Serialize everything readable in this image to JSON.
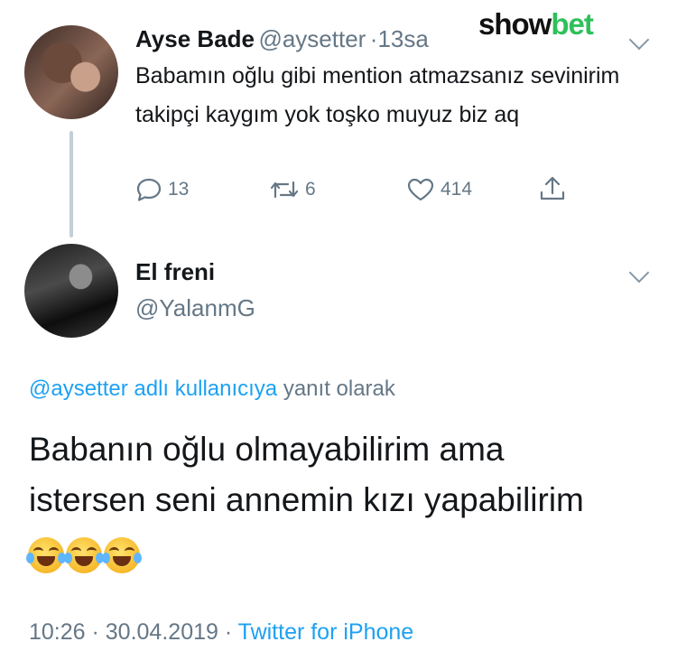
{
  "watermark": {
    "part1": "show",
    "part2": "bet"
  },
  "tweet1": {
    "author_name": "Ayse Bade",
    "author_handle": "@aysetter",
    "separator": "·",
    "time": "13sa",
    "text": "Babamın oğlu gibi mention atmazsanız sevinirim takipçi kaygım yok toşko muyuz biz aq",
    "actions": {
      "replies": "13",
      "retweets": "6",
      "likes": "414"
    }
  },
  "tweet2": {
    "author_name": "El freni",
    "author_handle": "@YalanmG",
    "reply_to_link": "@aysetter adlı kullanıcıya",
    "reply_to_rest": "yanıt olarak",
    "text_line1": "Babanın oğlu olmayabilirim ama",
    "text_line2": "istersen seni annemin kızı yapabilirim",
    "emojis": [
      "face-with-tears-of-joy",
      "face-with-tears-of-joy",
      "face-with-tears-of-joy"
    ],
    "timestamp": "10:26 · 30.04.2019 ·",
    "source": "Twitter for iPhone"
  },
  "colors": {
    "link": "#1da1f2",
    "muted": "#657786",
    "brand_green": "#2ec05a"
  }
}
